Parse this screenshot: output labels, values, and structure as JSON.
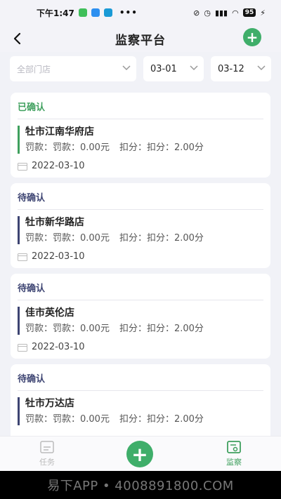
{
  "statusbar": {
    "time": "下午1:47",
    "dots": "•••",
    "battery": "95"
  },
  "nav": {
    "title": "监察平台",
    "add_label": "+"
  },
  "filters": {
    "store_placeholder": "全部门店",
    "date_from": "03-01",
    "date_to": "03-12"
  },
  "cards": [
    {
      "status": "已确认",
      "store": "牡市江南华府店",
      "fine": "罚款：罚款：0.00元",
      "points": "扣分：扣分：2.00分",
      "date": "2022-03-10"
    },
    {
      "status": "待确认",
      "store": "牡市新华路店",
      "fine": "罚款：罚款：0.00元",
      "points": "扣分：扣分：2.00分",
      "date": "2022-03-10"
    },
    {
      "status": "待确认",
      "store": "佳市英伦店",
      "fine": "罚款：罚款：0.00元",
      "points": "扣分：扣分：2.00分",
      "date": "2022-03-10"
    },
    {
      "status": "待确认",
      "store": "牡市万达店",
      "fine": "罚款：罚款：0.00元",
      "points": "扣分：扣分：2.00分",
      "date": "2022-03-10"
    }
  ],
  "tabbar": {
    "task": "任务",
    "supervise": "监察",
    "add_label": "+"
  },
  "watermark": "易下APP • 4008891800.COM",
  "colors": {
    "accent": "#3fae6a",
    "confirmed": "#3fa05e",
    "pending": "#3d4472"
  }
}
